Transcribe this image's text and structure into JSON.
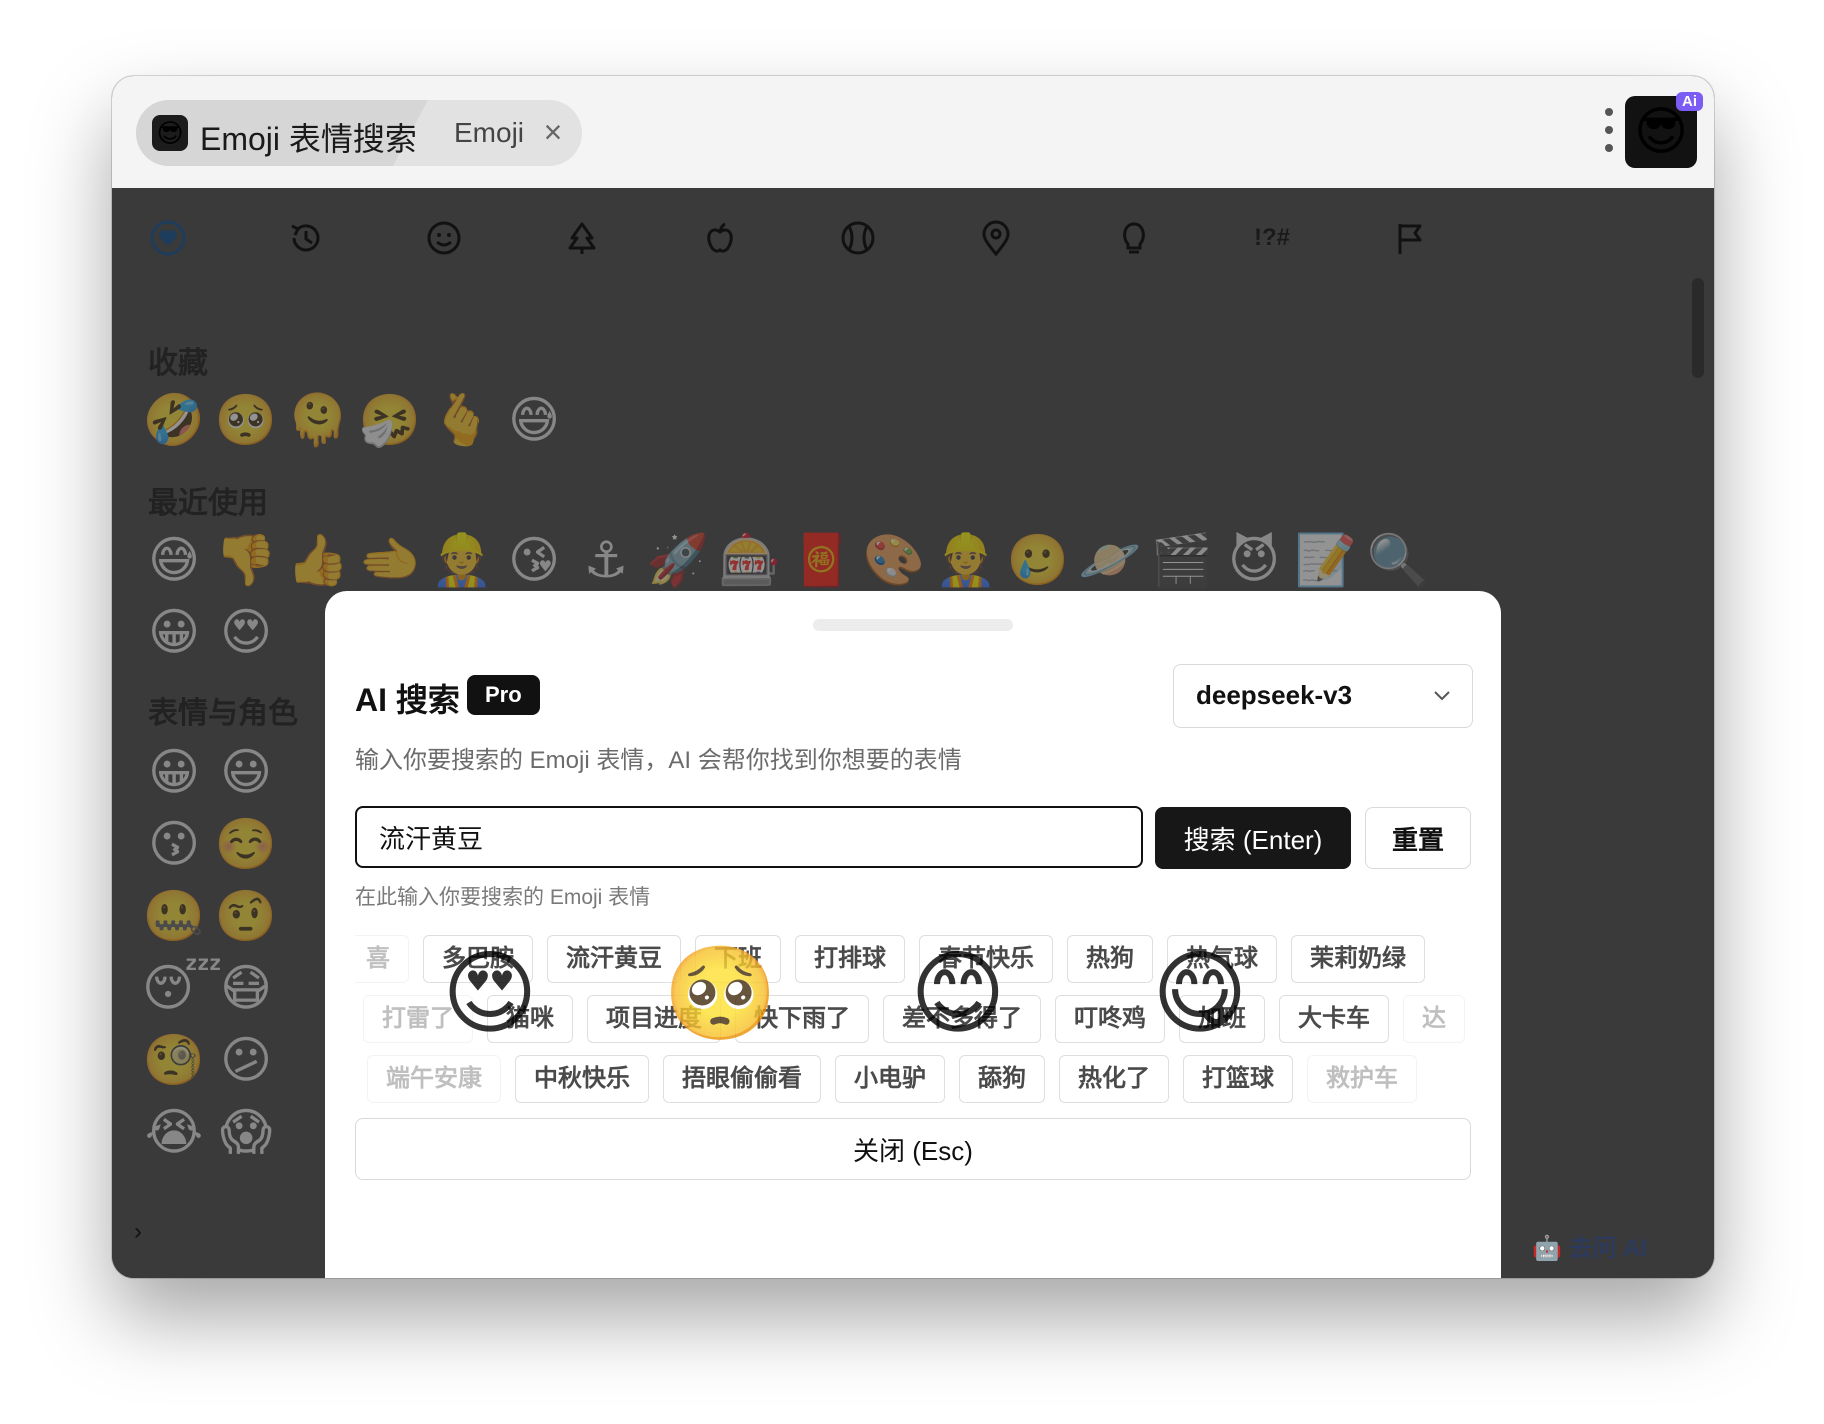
{
  "app": {
    "tab_title": "Emoji 表情搜索",
    "tab_second": "Emoji",
    "tab_icon": "😎",
    "logo_icon": "😎",
    "logo_badge": "Ai"
  },
  "categories": [
    {
      "icon": "heart-icon"
    },
    {
      "icon": "history-icon"
    },
    {
      "icon": "smiley-icon"
    },
    {
      "icon": "tree-icon"
    },
    {
      "icon": "apple-icon"
    },
    {
      "icon": "ball-icon"
    },
    {
      "icon": "pin-icon"
    },
    {
      "icon": "bulb-icon"
    },
    {
      "icon": "symbols-icon",
      "label": "!?#"
    },
    {
      "icon": "flag-icon"
    }
  ],
  "sections": {
    "favorites": "收藏",
    "recent": "最近使用",
    "smileys": "表情与角色"
  },
  "favorites_emojis": [
    "🤣",
    "🥺",
    "🫠",
    "🤧",
    "🫰",
    "😅"
  ],
  "recent_emojis_row1": [
    "😅",
    "👎",
    "👍",
    "🫲",
    "👷",
    "😘",
    "⚓",
    "🚀",
    "🎰",
    "🧧",
    "🎨",
    "👷",
    "🥲",
    "🪐",
    "🎬",
    "😈",
    "📝",
    "🔍"
  ],
  "recent_emojis_row2": [
    "😀",
    "😍"
  ],
  "smiley_left_col1": [
    "😀",
    "😗",
    "🤐",
    "😴",
    "🧐",
    "😭"
  ],
  "smiley_left_col2": [
    "😃",
    "☺️",
    "🤨",
    "😷",
    "😕",
    "😱"
  ],
  "smiley_right_col1": [
    "🤩",
    "🤔",
    "😪",
    "😎",
    "😥"
  ],
  "smiley_right_col2": [
    "😘",
    "🫲",
    "🤤",
    "🤓",
    "😢"
  ],
  "ask_ai": "去问 AI",
  "modal": {
    "title": "AI 搜索",
    "badge": "Pro",
    "model": "deepseek-v3",
    "description": "输入你要搜索的 Emoji 表情，AI 会帮你找到你想要的表情",
    "input_value": "流汗黄豆",
    "search_button": "搜索 (Enter)",
    "reset_button": "重置",
    "input_hint": "在此输入你要搜索的 Emoji 表情",
    "close_button": "关闭 (Esc)",
    "tags_row1": [
      "喜",
      "多巴胺",
      "流汗黄豆",
      "下班",
      "打排球",
      "春节快乐",
      "热狗",
      "热气球",
      "茉莉奶绿"
    ],
    "tags_row2": [
      "打雷了",
      "猫咪",
      "项目进度",
      "快下雨了",
      "差不多得了",
      "叮咚鸡",
      "加班",
      "大卡车",
      "达"
    ],
    "tags_row3": [
      "端午安康",
      "中秋快乐",
      "捂眼偷偷看",
      "小电驴",
      "舔狗",
      "热化了",
      "打篮球",
      "救护车"
    ],
    "floating_emojis": [
      "😍",
      "🥺",
      "😊",
      "😋"
    ]
  }
}
